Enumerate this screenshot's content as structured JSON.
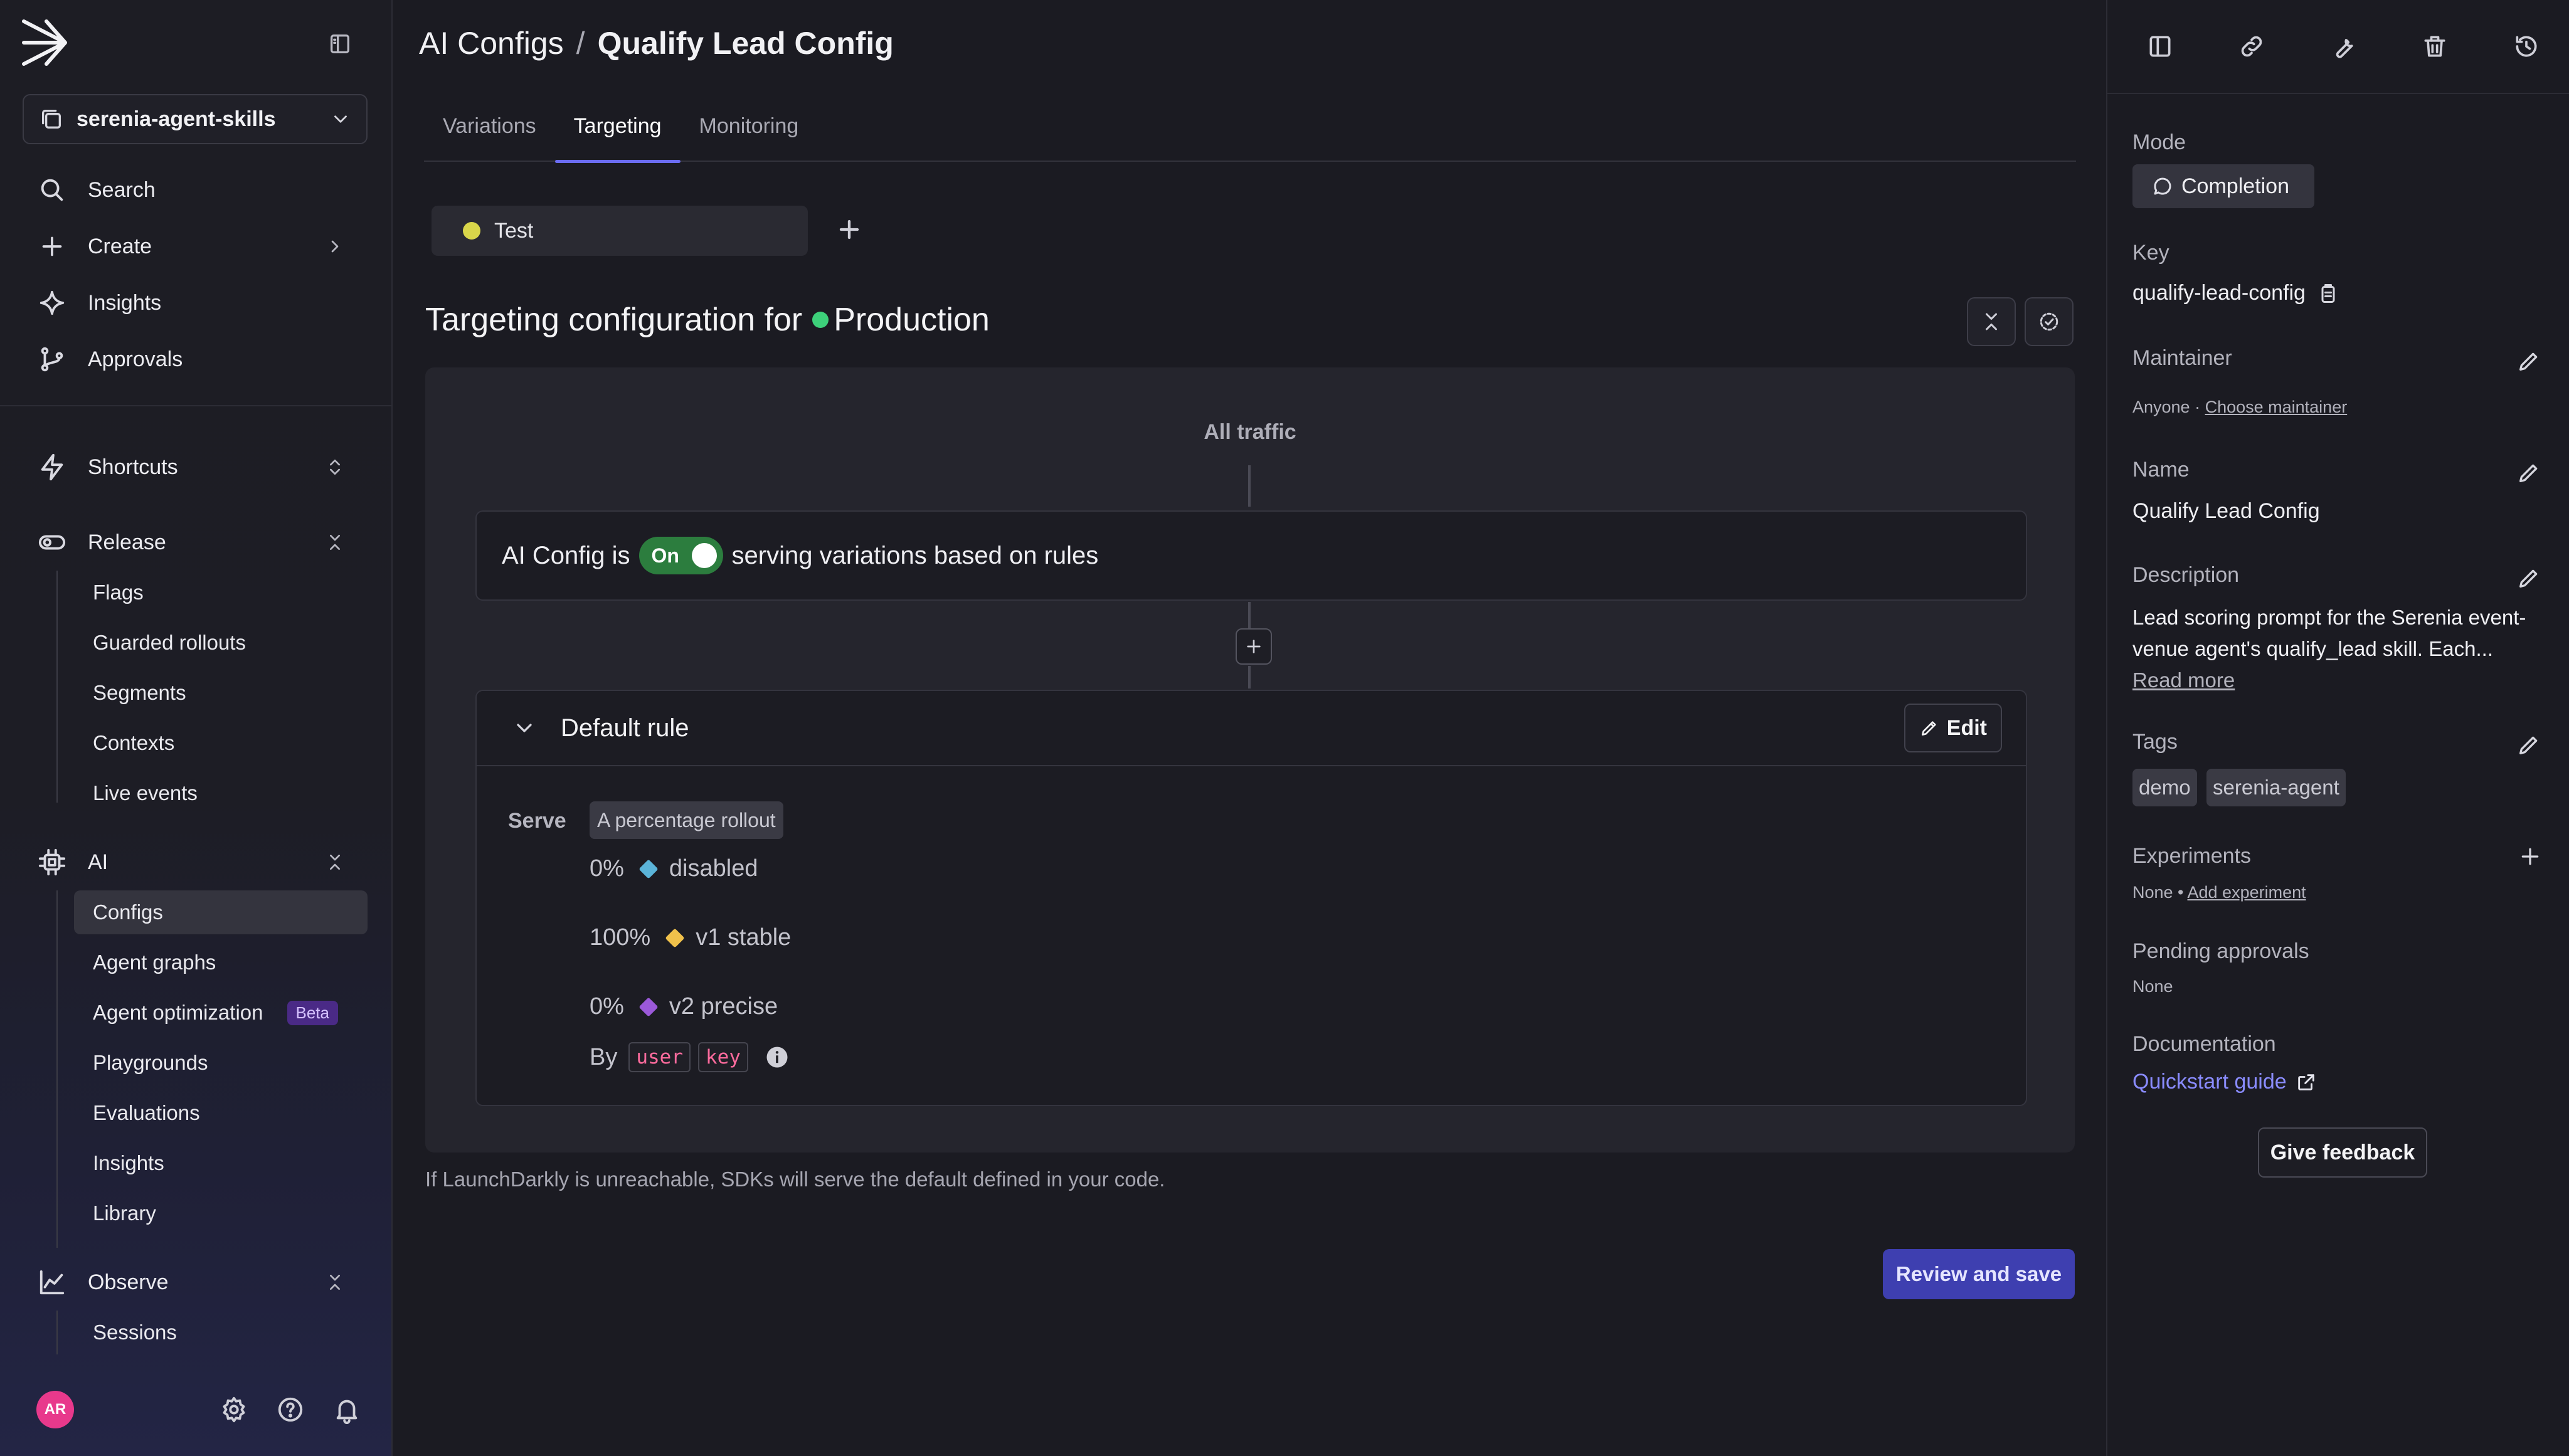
{
  "sidebar": {
    "project": "serenia-agent-skills",
    "nav": [
      {
        "label": "Search",
        "icon": "search-icon"
      },
      {
        "label": "Create",
        "icon": "plus-icon"
      },
      {
        "label": "Insights",
        "icon": "sparkle-icon"
      },
      {
        "label": "Approvals",
        "icon": "branch-icon"
      }
    ],
    "shortcuts_label": "Shortcuts",
    "release": {
      "label": "Release",
      "items": [
        "Flags",
        "Guarded rollouts",
        "Segments",
        "Contexts",
        "Live events"
      ]
    },
    "ai": {
      "label": "AI",
      "items": [
        "Configs",
        "Agent graphs",
        "Agent optimization",
        "Playgrounds",
        "Evaluations",
        "Insights",
        "Library"
      ],
      "active": "Configs",
      "beta_label": "Beta"
    },
    "observe": {
      "label": "Observe",
      "items": [
        "Sessions"
      ]
    },
    "avatar_initials": "AR"
  },
  "header": {
    "section": "AI Configs",
    "separator": "/",
    "current": "Qualify Lead Config"
  },
  "tabs": [
    "Variations",
    "Targeting",
    "Monitoring"
  ],
  "active_tab": "Targeting",
  "environment_chip": "Test",
  "targeting": {
    "title_prefix": "Targeting configuration for",
    "environment": "Production",
    "all_traffic": "All traffic",
    "state_prefix": "AI Config is",
    "toggle_label": "On",
    "state_suffix": "serving variations based on rules",
    "default_rule_title": "Default rule",
    "edit_label": "Edit",
    "serve_label": "Serve",
    "rollout_label": "A percentage rollout",
    "variations": [
      {
        "pct": "0%",
        "name": "disabled",
        "color": "#5bb4d9"
      },
      {
        "pct": "100%",
        "name": "v1 stable",
        "color": "#f0c14b"
      },
      {
        "pct": "0%",
        "name": "v2 precise",
        "color": "#9b59d9"
      }
    ],
    "by_label": "By",
    "by_context": "user",
    "by_attribute": "key",
    "footnote": "If LaunchDarkly is unreachable, SDKs will serve the default defined in your code.",
    "review_label": "Review and save"
  },
  "details": {
    "mode_label": "Mode",
    "mode_value": "Completion",
    "key_label": "Key",
    "key_value": "qualify-lead-config",
    "maintainer_label": "Maintainer",
    "maintainer_value": "Anyone",
    "maintainer_link": "Choose maintainer",
    "name_label": "Name",
    "name_value": "Qualify Lead Config",
    "description_label": "Description",
    "description_value": "Lead scoring prompt for the Serenia event-venue agent's qualify_lead skill. Each...",
    "read_more": "Read more",
    "tags_label": "Tags",
    "tags": [
      "demo",
      "serenia-agent"
    ],
    "experiments_label": "Experiments",
    "experiments_value": "None",
    "experiments_link": "Add experiment",
    "pending_label": "Pending approvals",
    "pending_value": "None",
    "docs_label": "Documentation",
    "docs_link": "Quickstart guide",
    "feedback_label": "Give feedback"
  }
}
